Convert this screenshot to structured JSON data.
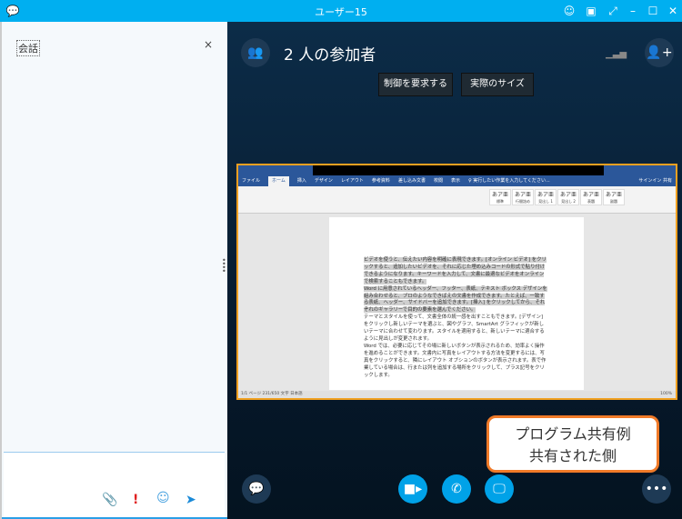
{
  "window": {
    "title": "ユーザー15",
    "accent": "#00aff0"
  },
  "left": {
    "conversation_label": "会話",
    "close": "×"
  },
  "header": {
    "participants": "2 人の参加者"
  },
  "buttons": {
    "request_control": "制御を要求する",
    "actual_size": "実際のサイズ"
  },
  "word": {
    "tabs": [
      "ファイル",
      "ホーム",
      "挿入",
      "デザイン",
      "レイアウト",
      "参考資料",
      "差し込み文書",
      "校閲",
      "表示",
      "♀ 実行したい作業を入力してください..."
    ],
    "signin": "サインイン  共有",
    "styles": [
      "あア亜",
      "あア亜",
      "あア亜",
      "あア亜",
      "あア亜",
      "あア亜"
    ],
    "style_names": [
      "標準",
      "行間詰め",
      "見出し 1",
      "見出し 2",
      "表題",
      "副題"
    ],
    "paragraphs": [
      "ビデオを使うと、伝えたい内容を明確に表現できます。[オンライン ビデオ] をクリックすると、追加したいビデオを、それに応じた埋め込みコードの形式で貼り付けできるようになります。キーワードを入力して、文書に最適なビデオをオンラインで検索することもできます。",
      "Word に用意されているヘッダー、フッター、表紙、テキスト ボックス デザインを組み合わせると、プロのようなできばえの文書を作成できます。たとえば、一致する表紙、ヘッダー、サイドバーを追加できます。[挿入] をクリックしてから、それぞれのギャラリーで目的の要素を選んでください。",
      "テーマとスタイルを使って、文書全体の統一感を出すこともできます。[デザイン] をクリックし新しいテーマを選ぶと、図やグラフ、SmartArt グラフィックが新しいテーマに合わせて変わります。スタイルを適用すると、新しいテーマに適合するように見出しが変更されます。",
      "Word では、必要に応じてその場に新しいボタンが表示されるため、効率よく操作を進めることができます。文書内に写真をレイアウトする方法を変更するには、写真をクリックすると、隣にレイアウト オプションのボタンが表示されます。表で作業している場合は、行または列を追加する場所をクリックして、プラス記号をクリックします。"
    ],
    "status": "1/1 ページ   231/650 文字   日本語",
    "zoom": "100%"
  },
  "callout": {
    "line1": "プログラム共有例",
    "line2": "共有された側"
  },
  "colors": {
    "panel_dark": "#0a2238",
    "call_blue": "#00a2e8",
    "callout_border": "#f07a28"
  }
}
